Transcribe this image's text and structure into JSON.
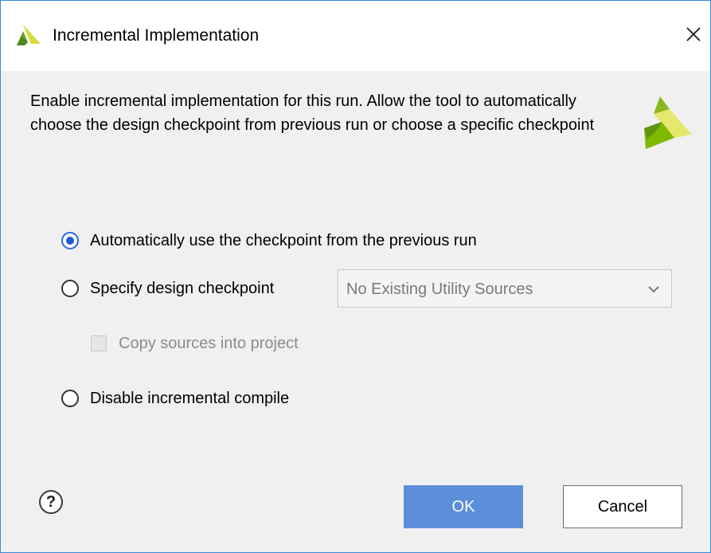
{
  "window": {
    "title": "Incremental Implementation",
    "close_icon": "close-icon",
    "logo_icon": "vivado-logo-icon"
  },
  "description": "Enable incremental implementation for this run. Allow the tool to automatically choose the design checkpoint from previous run or choose a specific checkpoint",
  "options": [
    {
      "label": "Automatically use the checkpoint from the previous run",
      "selected": true
    },
    {
      "label": "Specify design checkpoint",
      "selected": false
    },
    {
      "label": "Disable incremental compile",
      "selected": false
    }
  ],
  "checkpoint_select": {
    "value": "No Existing Utility Sources",
    "disabled": true
  },
  "copy_sources": {
    "label": "Copy sources into project",
    "checked": false,
    "disabled": true
  },
  "footer": {
    "help_icon": "help-icon",
    "help_label": "?",
    "ok_label": "OK",
    "cancel_label": "Cancel"
  },
  "colors": {
    "accent": "#5b8ed8",
    "window_border": "#3c8ad8",
    "logo_green": "#7fb800",
    "logo_yellow": "#e2e56a"
  }
}
